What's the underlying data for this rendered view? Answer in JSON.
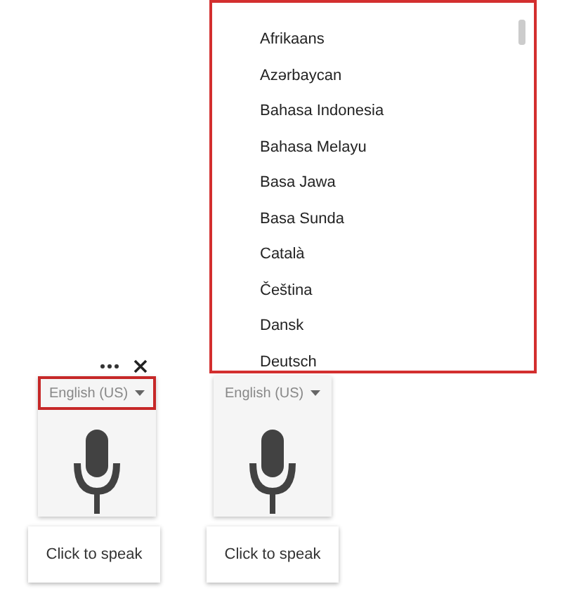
{
  "widgets": [
    {
      "toolbar": true,
      "language": "English (US)",
      "highlighted": true,
      "tooltip": "Click to speak"
    },
    {
      "toolbar": false,
      "language": "English (US)",
      "highlighted": false,
      "tooltip": "Click to speak"
    }
  ],
  "language_menu": {
    "highlighted": true,
    "options": [
      "Afrikaans",
      "Azərbaycan",
      "Bahasa Indonesia",
      "Bahasa Melayu",
      "Basa Jawa",
      "Basa Sunda",
      "Català",
      "Čeština",
      "Dansk",
      "Deutsch"
    ]
  }
}
